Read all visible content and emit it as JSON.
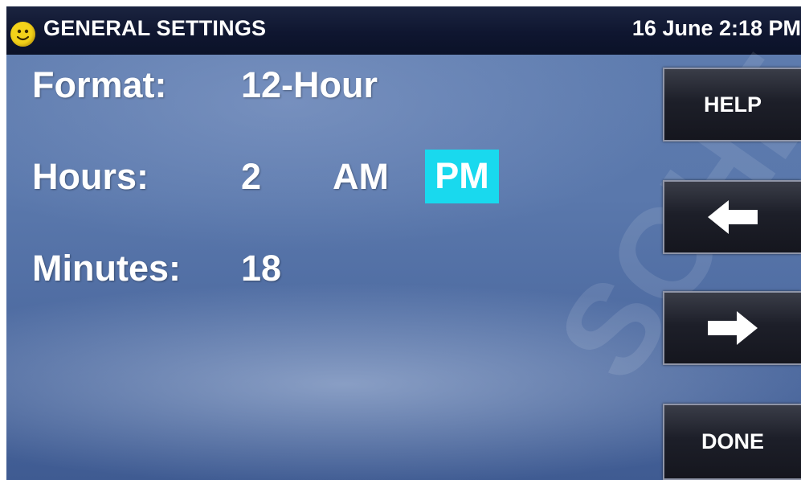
{
  "header": {
    "title": "GENERAL SETTINGS",
    "datetime": "16 June 2:18 PM",
    "status_icon": "smiley-icon",
    "status_icon_color": "#f3d21a"
  },
  "settings": {
    "format_label": "Format:",
    "format_value": "12-Hour",
    "hours_label": "Hours:",
    "hours_value": "2",
    "am_label": "AM",
    "pm_label": "PM",
    "selected_period": "PM",
    "minutes_label": "Minutes:",
    "minutes_value": "18",
    "highlight_color": "#19d9ee"
  },
  "side_buttons": {
    "help_label": "HELP",
    "back_icon": "arrow-left-icon",
    "forward_icon": "arrow-right-icon",
    "done_label": "DONE"
  },
  "watermark": "SCHE"
}
